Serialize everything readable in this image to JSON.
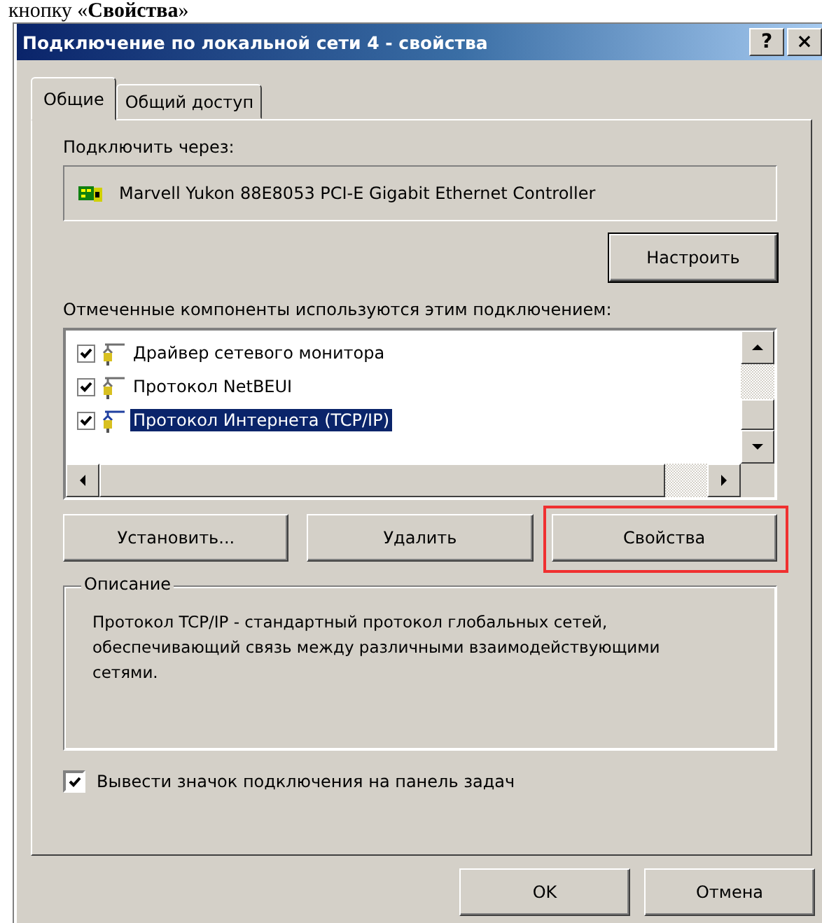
{
  "document_caption": "кнопку «**Свойства**»",
  "window": {
    "title": "Подключение по локальной сети 4 - свойства",
    "title_buttons": [
      "?",
      "×"
    ]
  },
  "tabs": [
    {
      "label": "Общие",
      "selected": true
    },
    {
      "label": "Общий доступ",
      "selected": false
    }
  ],
  "connect_via": {
    "label": "Подключить через:",
    "adapter": "Marvell Yukon 88E8053 PCI-E Gigabit Ethernet Controller",
    "configure_button": "Настроить"
  },
  "components": {
    "label": "Отмеченные компоненты используются этим подключением:",
    "items": [
      {
        "label": "Драйвер сетевого монитора",
        "checked": true,
        "selected": false
      },
      {
        "label": "Протокол NetBEUI",
        "checked": true,
        "selected": false
      },
      {
        "label": "Протокол Интернета (TCP/IP)",
        "checked": true,
        "selected": true
      }
    ],
    "buttons": [
      {
        "label": "Установить...",
        "highlighted": false
      },
      {
        "label": "Удалить",
        "highlighted": false
      },
      {
        "label": "Свойства",
        "highlighted": true
      }
    ]
  },
  "description": {
    "title": "Описание",
    "text": "Протокол TCP/IP - стандартный протокол глобальных сетей, обеспечивающий связь между различными взаимодействующими сетями."
  },
  "tray_icon_option": {
    "label": "Вывести значок подключения на панель задач",
    "checked": true
  },
  "dialog_buttons": [
    "OK",
    "Отмена"
  ]
}
